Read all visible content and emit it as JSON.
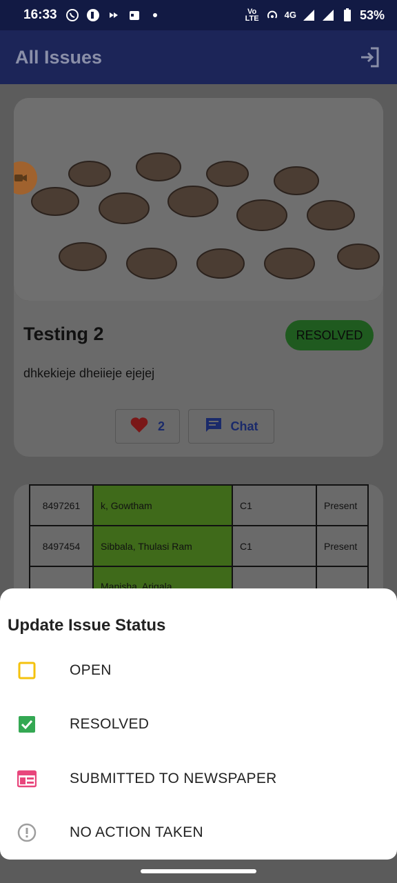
{
  "status_bar": {
    "time": "16:33",
    "network": "4G",
    "volte": "Vo LTE",
    "battery": "53%"
  },
  "app_bar": {
    "title": "All Issues",
    "action_icon": "logout-icon"
  },
  "issue_card": {
    "title": "Testing 2",
    "status": "RESOLVED",
    "description": "dhkekieje dheiieje ejejej",
    "likes": "2",
    "chat_label": "Chat"
  },
  "table": {
    "rows": [
      [
        "8497261",
        "k, Gowtham",
        "C1",
        "Present"
      ],
      [
        "8497454",
        "Sibbala, Thulasi Ram",
        "C1",
        "Present"
      ],
      [
        "",
        "Manisha, Arigala",
        "",
        ""
      ]
    ]
  },
  "sheet": {
    "title": "Update Issue Status",
    "options": [
      {
        "label": "OPEN",
        "icon": "checkbox-empty-icon",
        "color": "#f4c20d"
      },
      {
        "label": "RESOLVED",
        "icon": "checkbox-checked-icon",
        "color": "#34a853"
      },
      {
        "label": "SUBMITTED TO NEWSPAPER",
        "icon": "newspaper-icon",
        "color": "#e8467c"
      },
      {
        "label": "NO ACTION TAKEN",
        "icon": "alert-circle-icon",
        "color": "#9e9e9e"
      }
    ]
  }
}
